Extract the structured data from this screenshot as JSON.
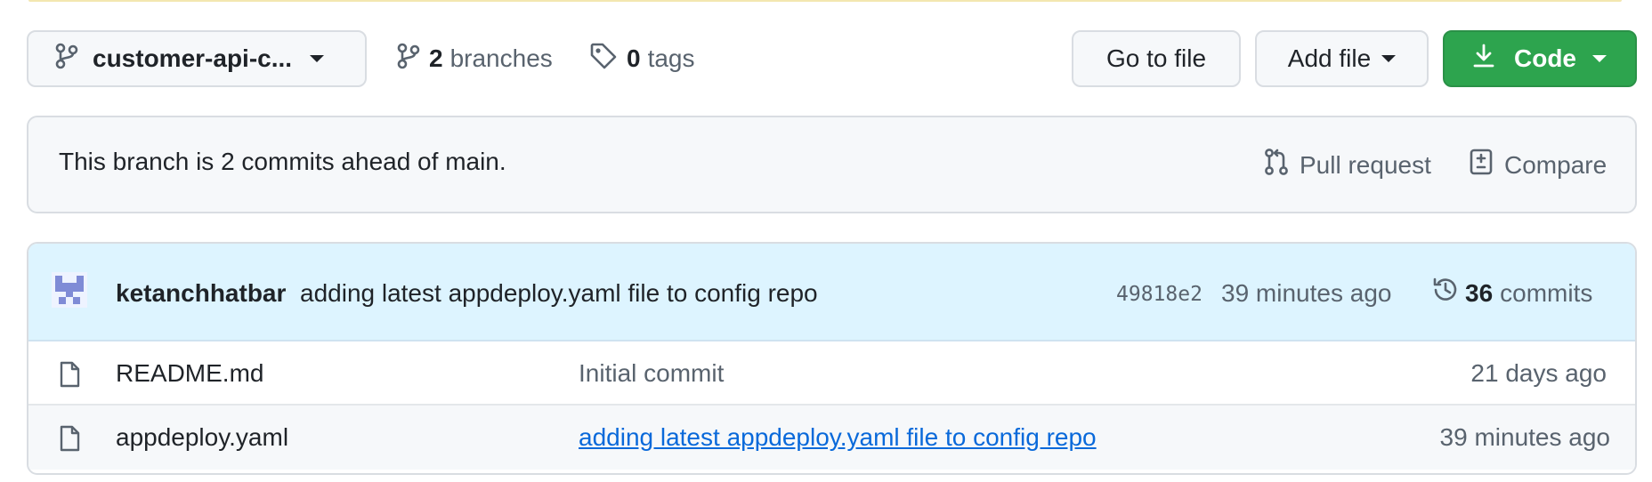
{
  "branch_bar": {
    "branch_name": "customer-api-c...",
    "branches_count": "2",
    "branches_label": "branches",
    "tags_count": "0",
    "tags_label": "tags",
    "go_to_file": "Go to file",
    "add_file": "Add file",
    "code": "Code"
  },
  "ahead": {
    "text": "This branch is 2 commits ahead of main.",
    "pull_request": "Pull request",
    "compare": "Compare"
  },
  "latest_commit": {
    "author": "ketanchhatbar",
    "message": "adding latest appdeploy.yaml file to config repo",
    "sha": "49818e2",
    "time": "39 minutes ago",
    "commits_count": "36",
    "commits_label": "commits"
  },
  "files": [
    {
      "name": "README.md",
      "message": "Initial commit",
      "time": "21 days ago"
    },
    {
      "name": "appdeploy.yaml",
      "message": "adding latest appdeploy.yaml file to config repo",
      "time": "39 minutes ago"
    }
  ],
  "colors": {
    "primary_button": "#2da44e",
    "link": "#0969da",
    "commit_header_bg": "#ddf4ff"
  },
  "icons": [
    "git-branch-icon",
    "tag-icon",
    "download-icon",
    "pull-request-icon",
    "compare-icon",
    "history-icon",
    "file-icon"
  ]
}
